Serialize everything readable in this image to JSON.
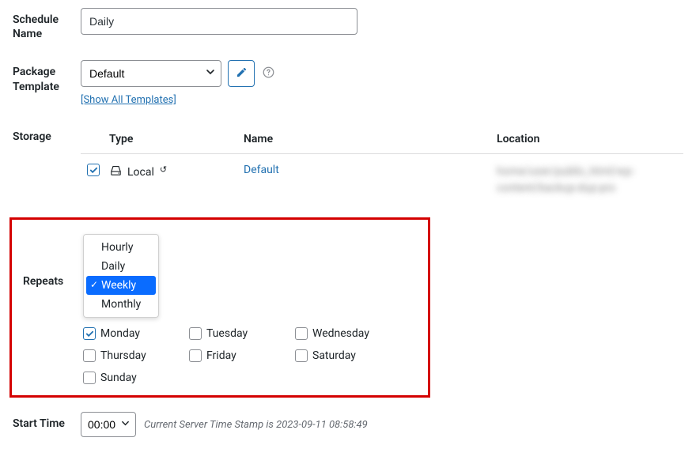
{
  "scheduleName": {
    "label": "Schedule Name",
    "value": "Daily"
  },
  "packageTemplate": {
    "label": "Package Template",
    "selected": "Default",
    "showAll": "[Show All Templates]"
  },
  "storage": {
    "label": "Storage",
    "headers": {
      "type": "Type",
      "name": "Name",
      "location": "Location"
    },
    "row": {
      "checked": true,
      "type": "Local",
      "name": "Default",
      "location": "home/user/public_html/wp-content/backup-dup-pro"
    }
  },
  "repeats": {
    "label": "Repeats",
    "options": [
      "Hourly",
      "Daily",
      "Weekly",
      "Monthly"
    ],
    "selected": "Weekly",
    "days": [
      {
        "label": "Monday",
        "checked": true
      },
      {
        "label": "Tuesday",
        "checked": false
      },
      {
        "label": "Wednesday",
        "checked": false
      },
      {
        "label": "Thursday",
        "checked": false
      },
      {
        "label": "Friday",
        "checked": false
      },
      {
        "label": "Saturday",
        "checked": false
      },
      {
        "label": "Sunday",
        "checked": false
      }
    ]
  },
  "startTime": {
    "label": "Start Time",
    "value": "00:00",
    "serverPrefix": "Current Server Time Stamp is ",
    "serverTimestamp": "2023-09-11 08:58:49"
  }
}
